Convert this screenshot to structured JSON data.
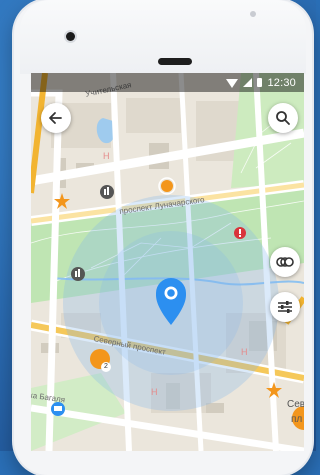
{
  "status_bar": {
    "time": "12:30"
  },
  "map": {
    "street_labels": {
      "top": "Учительская",
      "prospect_lunacharskogo": "проспект Луначарского",
      "severny_prospect": "Северный проспект",
      "bagalya": "ка Багаля",
      "right_edge_1": "Сев",
      "right_edge_2": "пл"
    },
    "cluster_badge": "2"
  },
  "controls": {
    "back": "back-arrow-icon",
    "search": "search-icon",
    "layers": "layers-icon",
    "filters": "sliders-icon"
  },
  "colors": {
    "accent_blue": "#2c8ff0",
    "orange_marker": "#f3961c",
    "background": "#2a6fb7"
  }
}
